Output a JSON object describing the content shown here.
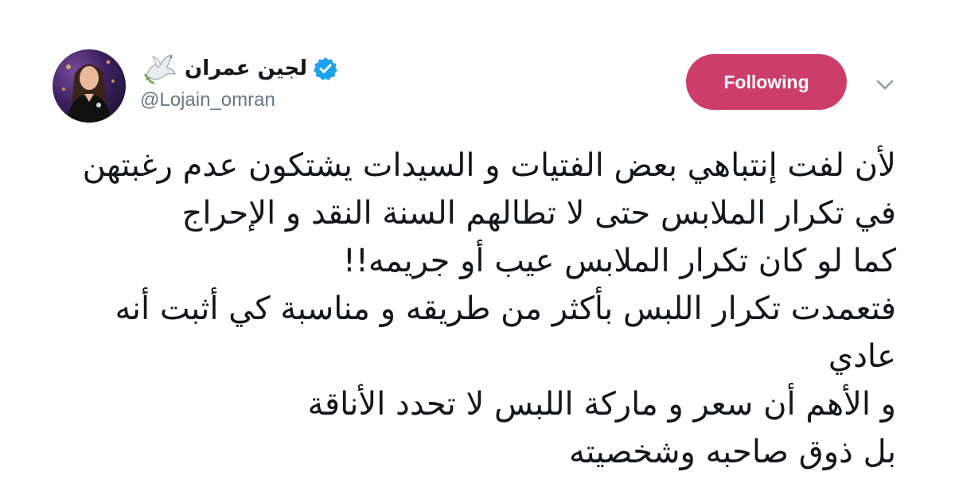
{
  "user": {
    "display_name": "لجين عمران",
    "handle": "@Lojain_omran",
    "emoji": "dove-icon",
    "verified": true
  },
  "follow_button": {
    "label": "Following",
    "color": "#cc3d69"
  },
  "menu": {
    "icon": "chevron-down-icon"
  },
  "tweet": {
    "lines": [
      "لأن لفت إنتباهي بعض الفتيات و السيدات يشتكون عدم رغبتهن",
      "في تكرار الملابس حتى لا تطالهم السنة النقد و الإحراج",
      "كما لو كان تكرار الملابس عيب أو جريمه!!",
      "فتعمدت تكرار اللبس بأكثر من طريقه و مناسبة كي أثبت أنه",
      "عادي",
      "و الأهم أن سعر و ماركة اللبس لا تحدد الأناقة",
      "بل ذوق صاحبه وشخصيته"
    ]
  },
  "colors": {
    "text": "#14171a",
    "secondary": "#657786",
    "verified": "#1da1f2"
  }
}
